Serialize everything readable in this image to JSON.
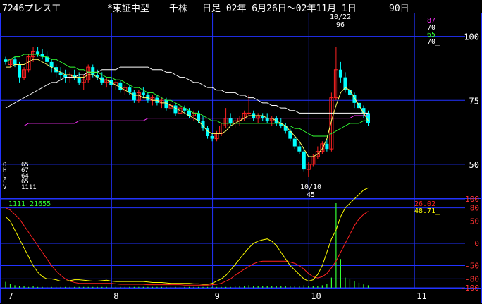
{
  "header": {
    "code_name": "7246プレス工",
    "market": "*東証中型",
    "unit": "千株",
    "range": "日足 02年 6月26日～02年11月 1日",
    "days": "90日"
  },
  "ohlcv_panel": {
    "labels": [
      "O",
      "H",
      "L",
      "C",
      "V"
    ],
    "values": [
      "65",
      "67",
      "64",
      "65",
      "1111"
    ]
  },
  "price_axis": {
    "ticks": [
      "100",
      "75",
      "50"
    ]
  },
  "ma_legend": [
    {
      "text": "87",
      "color": "#ff33ff"
    },
    {
      "text": "70",
      "color": "#ffffff"
    },
    {
      "text": "65",
      "color": "#33ff33"
    },
    {
      "text": "70_",
      "color": "#ffffff"
    }
  ],
  "annotations": {
    "high_date": "10/22",
    "high_value": "96",
    "low_date": "10/10",
    "low_value": "45"
  },
  "volume_label": "1111 21655",
  "osc_legend": [
    {
      "text": "26.02",
      "color": "#ff2222"
    },
    {
      "text": "48.71_",
      "color": "#ffff00"
    }
  ],
  "osc_axis": {
    "ticks": [
      "100",
      "80",
      "50",
      "0",
      "-50",
      "-80",
      "-100"
    ]
  },
  "month_labels": [
    "7",
    "8",
    "9",
    "10",
    "11"
  ],
  "colors": {
    "grid": "#2233ff",
    "up": "#ff2222",
    "down": "#00ffff",
    "ma_short": "#ffff66",
    "ma_mid": "#33ff33",
    "ma_long": "#ffffff",
    "ma_xlong": "#ff33ff",
    "volume": "#33ff33",
    "osc_fast": "#ffff00",
    "osc_slow": "#ff2222"
  },
  "chart_data": {
    "type": "candlestick",
    "price_ylim": [
      37,
      109
    ],
    "osc_ylim": [
      -100,
      100
    ],
    "candles": [
      [
        91,
        92,
        89,
        90
      ],
      [
        89,
        91,
        88,
        91
      ],
      [
        91,
        92,
        88,
        89
      ],
      [
        89,
        90,
        82,
        84
      ],
      [
        84,
        88,
        83,
        87
      ],
      [
        87,
        93,
        86,
        92
      ],
      [
        92,
        96,
        90,
        94
      ],
      [
        94,
        96,
        92,
        93
      ],
      [
        93,
        95,
        91,
        92
      ],
      [
        92,
        94,
        89,
        90
      ],
      [
        90,
        91,
        86,
        88
      ],
      [
        88,
        89,
        84,
        86
      ],
      [
        86,
        88,
        83,
        85
      ],
      [
        85,
        87,
        82,
        84
      ],
      [
        84,
        86,
        82,
        85
      ],
      [
        85,
        87,
        83,
        84
      ],
      [
        84,
        86,
        81,
        82
      ],
      [
        82,
        85,
        79,
        83
      ],
      [
        83,
        89,
        82,
        88
      ],
      [
        88,
        89,
        84,
        85
      ],
      [
        85,
        87,
        83,
        84
      ],
      [
        84,
        86,
        81,
        82
      ],
      [
        82,
        84,
        80,
        83
      ],
      [
        83,
        84,
        80,
        81
      ],
      [
        81,
        83,
        79,
        82
      ],
      [
        82,
        83,
        78,
        79
      ],
      [
        79,
        81,
        77,
        80
      ],
      [
        80,
        81,
        77,
        78
      ],
      [
        78,
        79,
        74,
        75
      ],
      [
        75,
        79,
        74,
        78
      ],
      [
        78,
        80,
        76,
        77
      ],
      [
        77,
        78,
        74,
        75
      ],
      [
        75,
        77,
        73,
        76
      ],
      [
        76,
        77,
        73,
        74
      ],
      [
        74,
        76,
        72,
        75
      ],
      [
        75,
        76,
        71,
        72
      ],
      [
        72,
        74,
        70,
        73
      ],
      [
        73,
        74,
        69,
        70
      ],
      [
        70,
        73,
        69,
        72
      ],
      [
        72,
        73,
        70,
        71
      ],
      [
        71,
        72,
        68,
        69
      ],
      [
        69,
        71,
        67,
        70
      ],
      [
        70,
        71,
        66,
        67
      ],
      [
        67,
        69,
        63,
        64
      ],
      [
        64,
        65,
        60,
        61
      ],
      [
        61,
        62,
        59,
        60
      ],
      [
        60,
        63,
        59,
        62
      ],
      [
        62,
        66,
        61,
        65
      ],
      [
        65,
        72,
        64,
        68
      ],
      [
        68,
        70,
        65,
        66
      ],
      [
        66,
        68,
        64,
        67
      ],
      [
        67,
        69,
        65,
        68
      ],
      [
        68,
        71,
        67,
        70
      ],
      [
        70,
        77,
        69,
        70
      ],
      [
        70,
        71,
        67,
        68
      ],
      [
        68,
        70,
        66,
        69
      ],
      [
        69,
        70,
        67,
        68
      ],
      [
        68,
        70,
        66,
        67
      ],
      [
        67,
        69,
        65,
        68
      ],
      [
        68,
        69,
        65,
        66
      ],
      [
        66,
        68,
        64,
        65
      ],
      [
        65,
        66,
        62,
        63
      ],
      [
        63,
        64,
        59,
        60
      ],
      [
        60,
        61,
        56,
        57
      ],
      [
        57,
        59,
        54,
        55
      ],
      [
        55,
        56,
        47,
        48
      ],
      [
        48,
        51,
        45,
        50
      ],
      [
        50,
        54,
        49,
        53
      ],
      [
        53,
        57,
        52,
        55
      ],
      [
        55,
        59,
        54,
        58
      ],
      [
        58,
        60,
        55,
        56
      ],
      [
        56,
        78,
        55,
        76
      ],
      [
        76,
        96,
        75,
        87
      ],
      [
        87,
        90,
        82,
        84
      ],
      [
        84,
        86,
        78,
        79
      ],
      [
        79,
        82,
        76,
        77
      ],
      [
        77,
        78,
        72,
        74
      ],
      [
        74,
        76,
        71,
        72
      ],
      [
        72,
        73,
        68,
        70
      ],
      [
        70,
        71,
        65,
        66
      ]
    ],
    "volume": [
      7,
      5,
      3,
      2,
      2,
      1,
      2,
      1,
      1,
      1,
      1,
      1,
      1,
      1,
      1,
      1,
      1,
      1,
      1,
      1,
      1,
      1,
      1,
      1,
      1,
      1,
      1,
      1,
      1,
      1,
      1,
      1,
      1,
      1,
      1,
      1,
      1,
      1,
      1,
      1,
      1,
      1,
      1,
      1,
      1,
      1,
      1,
      1,
      1,
      1,
      2,
      2,
      2,
      3,
      2,
      2,
      2,
      2,
      2,
      2,
      2,
      2,
      2,
      2,
      2,
      3,
      2,
      2,
      2,
      3,
      5,
      12,
      100,
      34,
      12,
      10,
      8,
      6,
      4,
      3
    ],
    "ma_short": [
      88,
      88,
      89,
      89,
      89,
      90,
      91,
      91,
      90,
      89,
      88,
      87,
      86,
      85,
      85,
      84,
      84,
      84,
      85,
      85,
      84,
      83,
      83,
      82,
      81,
      80,
      79,
      78,
      77,
      77,
      76,
      76,
      75,
      75,
      74,
      74,
      73,
      72,
      71,
      70,
      69,
      68,
      67,
      65,
      63,
      62,
      62,
      62,
      63,
      65,
      66,
      67,
      68,
      69,
      69,
      69,
      69,
      68,
      68,
      67,
      66,
      65,
      63,
      61,
      59,
      56,
      53,
      53,
      54,
      56,
      60,
      67,
      73,
      78,
      80,
      79,
      76,
      73,
      70,
      67
    ],
    "ma_mid": [
      90,
      91,
      92,
      92,
      93,
      93,
      93,
      93,
      92,
      92,
      91,
      91,
      90,
      89,
      88,
      88,
      87,
      87,
      86,
      86,
      86,
      85,
      84,
      84,
      83,
      83,
      82,
      81,
      80,
      80,
      79,
      78,
      78,
      77,
      76,
      75,
      75,
      74,
      73,
      72,
      71,
      70,
      70,
      69,
      68,
      67,
      67,
      66,
      66,
      66,
      66,
      66,
      66,
      66,
      66,
      66,
      66,
      66,
      66,
      66,
      66,
      65,
      65,
      64,
      64,
      63,
      62,
      61,
      61,
      61,
      61,
      62,
      63,
      64,
      65,
      66,
      66,
      66,
      67,
      67
    ],
    "ma_long": [
      72,
      73,
      74,
      75,
      76,
      77,
      78,
      79,
      80,
      81,
      82,
      82,
      83,
      84,
      84,
      84,
      85,
      85,
      86,
      86,
      86,
      87,
      87,
      87,
      87,
      88,
      88,
      88,
      88,
      88,
      88,
      88,
      87,
      87,
      87,
      86,
      86,
      85,
      84,
      84,
      83,
      82,
      82,
      81,
      80,
      80,
      79,
      79,
      78,
      78,
      78,
      77,
      77,
      76,
      76,
      75,
      74,
      74,
      73,
      73,
      72,
      72,
      71,
      71,
      70,
      70,
      70,
      70,
      70,
      70,
      70,
      70,
      70,
      70,
      70,
      70,
      70,
      70,
      70,
      70
    ],
    "ma_xlong": [
      65,
      65,
      65,
      65,
      65,
      66,
      66,
      66,
      66,
      66,
      66,
      66,
      66,
      66,
      66,
      66,
      67,
      67,
      67,
      67,
      67,
      67,
      67,
      67,
      67,
      67,
      67,
      67,
      67,
      67,
      67,
      68,
      68,
      68,
      68,
      68,
      68,
      68,
      68,
      68,
      68,
      68,
      68,
      68,
      68,
      68,
      68,
      68,
      68,
      68,
      68,
      68,
      68,
      68,
      68,
      68,
      68,
      68,
      68,
      68,
      68,
      68,
      68,
      68,
      68,
      68,
      68,
      68,
      68,
      68,
      68,
      68,
      68,
      68,
      68,
      68,
      69,
      69,
      69,
      69
    ],
    "osc_fast": [
      60,
      50,
      30,
      10,
      -10,
      -30,
      -50,
      -65,
      -75,
      -80,
      -80,
      -82,
      -85,
      -85,
      -84,
      -82,
      -82,
      -83,
      -84,
      -85,
      -85,
      -84,
      -83,
      -85,
      -86,
      -86,
      -86,
      -86,
      -86,
      -86,
      -86,
      -87,
      -88,
      -88,
      -88,
      -89,
      -90,
      -90,
      -90,
      -90,
      -90,
      -91,
      -91,
      -92,
      -92,
      -90,
      -85,
      -80,
      -72,
      -60,
      -48,
      -35,
      -22,
      -10,
      0,
      5,
      8,
      10,
      5,
      -5,
      -20,
      -35,
      -50,
      -60,
      -70,
      -80,
      -85,
      -82,
      -70,
      -50,
      -20,
      10,
      30,
      60,
      80,
      90,
      100,
      110,
      120,
      125
    ],
    "osc_slow": [
      80,
      75,
      65,
      55,
      40,
      25,
      10,
      -5,
      -20,
      -35,
      -50,
      -62,
      -72,
      -80,
      -85,
      -88,
      -90,
      -90,
      -90,
      -90,
      -90,
      -90,
      -90,
      -90,
      -91,
      -92,
      -92,
      -92,
      -92,
      -92,
      -92,
      -93,
      -93,
      -93,
      -93,
      -93,
      -93,
      -93,
      -93,
      -94,
      -94,
      -94,
      -94,
      -94,
      -94,
      -93,
      -92,
      -90,
      -85,
      -80,
      -72,
      -65,
      -58,
      -52,
      -46,
      -42,
      -40,
      -40,
      -40,
      -40,
      -40,
      -40,
      -42,
      -45,
      -50,
      -58,
      -68,
      -75,
      -78,
      -75,
      -68,
      -55,
      -40,
      -20,
      0,
      20,
      40,
      55,
      65,
      72
    ]
  }
}
